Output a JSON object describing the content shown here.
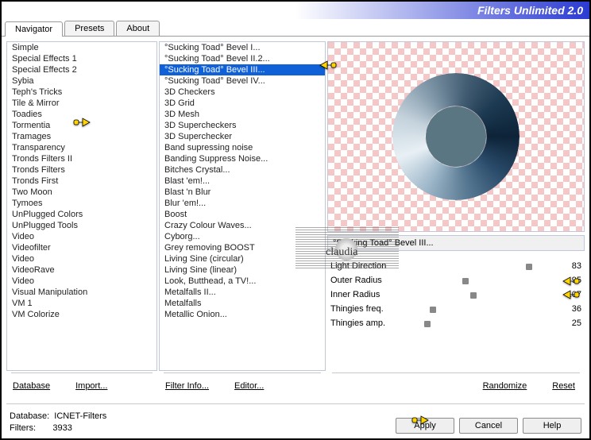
{
  "title": "Filters Unlimited 2.0",
  "tabs": {
    "navigator": "Navigator",
    "presets": "Presets",
    "about": "About"
  },
  "col1": [
    "Simple",
    "Special Effects 1",
    "Special Effects 2",
    "Sybia",
    "Teph's Tricks",
    "Tile & Mirror",
    "Toadies",
    "Tormentia",
    "Tramages",
    "Transparency",
    "Tronds Filters II",
    "Tronds Filters",
    "Tronds First",
    "Two Moon",
    "Tymoes",
    "UnPlugged Colors",
    "UnPlugged Tools",
    "Video",
    "Videofilter",
    "Video",
    "VideoRave",
    "Video",
    "Visual Manipulation",
    "VM 1",
    "VM Colorize"
  ],
  "col2": [
    "°Sucking Toad°  Bevel I...",
    "°Sucking Toad°  Bevel II.2...",
    "°Sucking Toad°  Bevel III...",
    "°Sucking Toad°  Bevel IV...",
    "3D Checkers",
    "3D Grid",
    "3D Mesh",
    "3D Supercheckers",
    "3D Superchecker",
    "Band supressing noise",
    "Banding Suppress Noise...",
    "Bitches Crystal...",
    "Blast 'em!...",
    "Blast 'n Blur",
    "Blur 'em!...",
    "Boost",
    "Crazy Colour Waves...",
    "Cyborg...",
    "Grey removing BOOST",
    "Living Sine (circular)",
    "Living Sine (linear)",
    "Look, Butthead, a TV!...",
    "Metalfalls II...",
    "Metalfalls",
    "Metallic Onion..."
  ],
  "selected_col1_index": 6,
  "selected_col2_index": 2,
  "current_filter": "°Sucking Toad°  Bevel III...",
  "sliders": [
    {
      "label": "Light Direction",
      "value": 83,
      "pos": 80
    },
    {
      "label": "Outer Radius",
      "value": 95,
      "pos": 36
    },
    {
      "label": "Inner Radius",
      "value": 107,
      "pos": 42
    },
    {
      "label": "Thingies freq.",
      "value": 36,
      "pos": 14
    },
    {
      "label": "Thingies amp.",
      "value": 25,
      "pos": 10
    }
  ],
  "links": {
    "database": "Database",
    "import": "Import...",
    "filter_info": "Filter Info...",
    "editor": "Editor...",
    "randomize": "Randomize",
    "reset": "Reset"
  },
  "footer": {
    "db_label": "Database:",
    "db_value": "ICNET-Filters",
    "filters_label": "Filters:",
    "filters_value": "3933"
  },
  "buttons": {
    "apply": "Apply",
    "cancel": "Cancel",
    "help": "Help"
  },
  "watermark": "claudia"
}
